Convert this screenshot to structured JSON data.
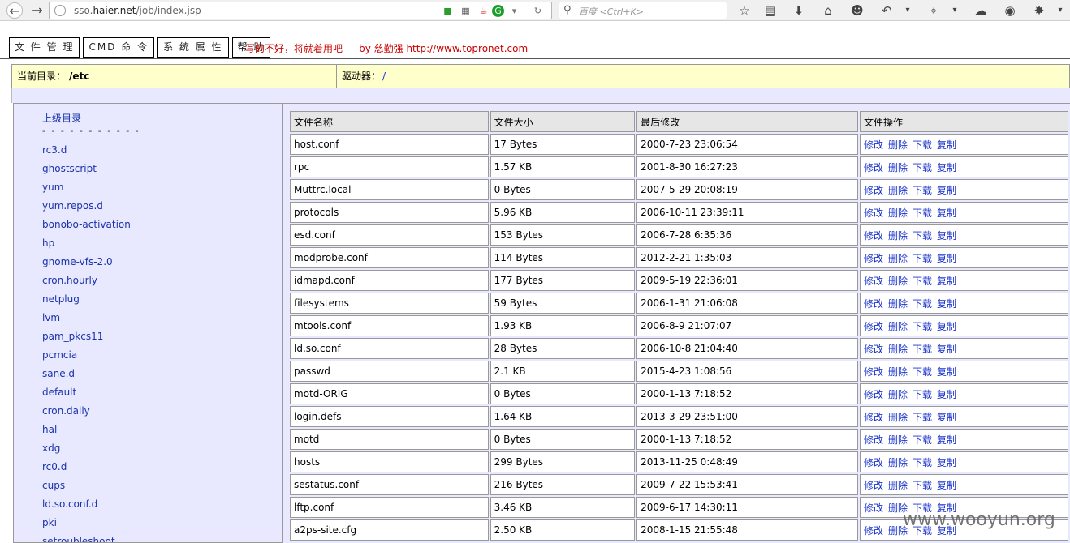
{
  "browser": {
    "url_prefix": "sso.",
    "url_domain": "haier.net",
    "url_path": "/job/index.jsp",
    "search_placeholder": "百度 <Ctrl+K>"
  },
  "menu": {
    "file_manage": "文 件 管 理",
    "cmd": "CMD 命 令",
    "system": "系 统 属 性",
    "help": "帮 助",
    "note": "写的不好，将就着用吧 - - by 慈勤强 http://www.topronet.com"
  },
  "dirbar": {
    "current_label": "当前目录：",
    "current_value": "/etc",
    "drive_label": "驱动器：",
    "drive_value": "/"
  },
  "tree": {
    "parent": "上级目录",
    "separator": "- - - - - - - - - - -",
    "items": [
      "rc3.d",
      "ghostscript",
      "yum",
      "yum.repos.d",
      "bonobo-activation",
      "hp",
      "gnome-vfs-2.0",
      "cron.hourly",
      "netplug",
      "lvm",
      "pam_pkcs11",
      "pcmcia",
      "sane.d",
      "default",
      "cron.daily",
      "hal",
      "xdg",
      "rc0.d",
      "cups",
      "ld.so.conf.d",
      "pki",
      "setroubleshoot"
    ]
  },
  "table": {
    "headers": [
      "文件名称",
      "文件大小",
      "最后修改",
      "文件操作"
    ],
    "ops": [
      "修改",
      "删除",
      "下载",
      "复制"
    ],
    "rows": [
      [
        "host.conf",
        "17 Bytes",
        "2000-7-23 23:06:54"
      ],
      [
        "rpc",
        "1.57 KB",
        "2001-8-30 16:27:23"
      ],
      [
        "Muttrc.local",
        "0 Bytes",
        "2007-5-29 20:08:19"
      ],
      [
        "protocols",
        "5.96 KB",
        "2006-10-11 23:39:11"
      ],
      [
        "esd.conf",
        "153 Bytes",
        "2006-7-28 6:35:36"
      ],
      [
        "modprobe.conf",
        "114 Bytes",
        "2012-2-21 1:35:03"
      ],
      [
        "idmapd.conf",
        "177 Bytes",
        "2009-5-19 22:36:01"
      ],
      [
        "filesystems",
        "59 Bytes",
        "2006-1-31 21:06:08"
      ],
      [
        "mtools.conf",
        "1.93 KB",
        "2006-8-9 21:07:07"
      ],
      [
        "ld.so.conf",
        "28 Bytes",
        "2006-10-8 21:04:40"
      ],
      [
        "passwd",
        "2.1 KB",
        "2015-4-23 1:08:56"
      ],
      [
        "motd-ORIG",
        "0 Bytes",
        "2000-1-13 7:18:52"
      ],
      [
        "login.defs",
        "1.64 KB",
        "2013-3-29 23:51:00"
      ],
      [
        "motd",
        "0 Bytes",
        "2000-1-13 7:18:52"
      ],
      [
        "hosts",
        "299 Bytes",
        "2013-11-25 0:48:49"
      ],
      [
        "sestatus.conf",
        "216 Bytes",
        "2009-7-22 15:53:41"
      ],
      [
        "lftp.conf",
        "3.46 KB",
        "2009-6-17 14:30:11"
      ],
      [
        "a2ps-site.cfg",
        "2.50 KB",
        "2008-1-15 21:55:48"
      ]
    ]
  },
  "watermark": "www.wooyun.org"
}
